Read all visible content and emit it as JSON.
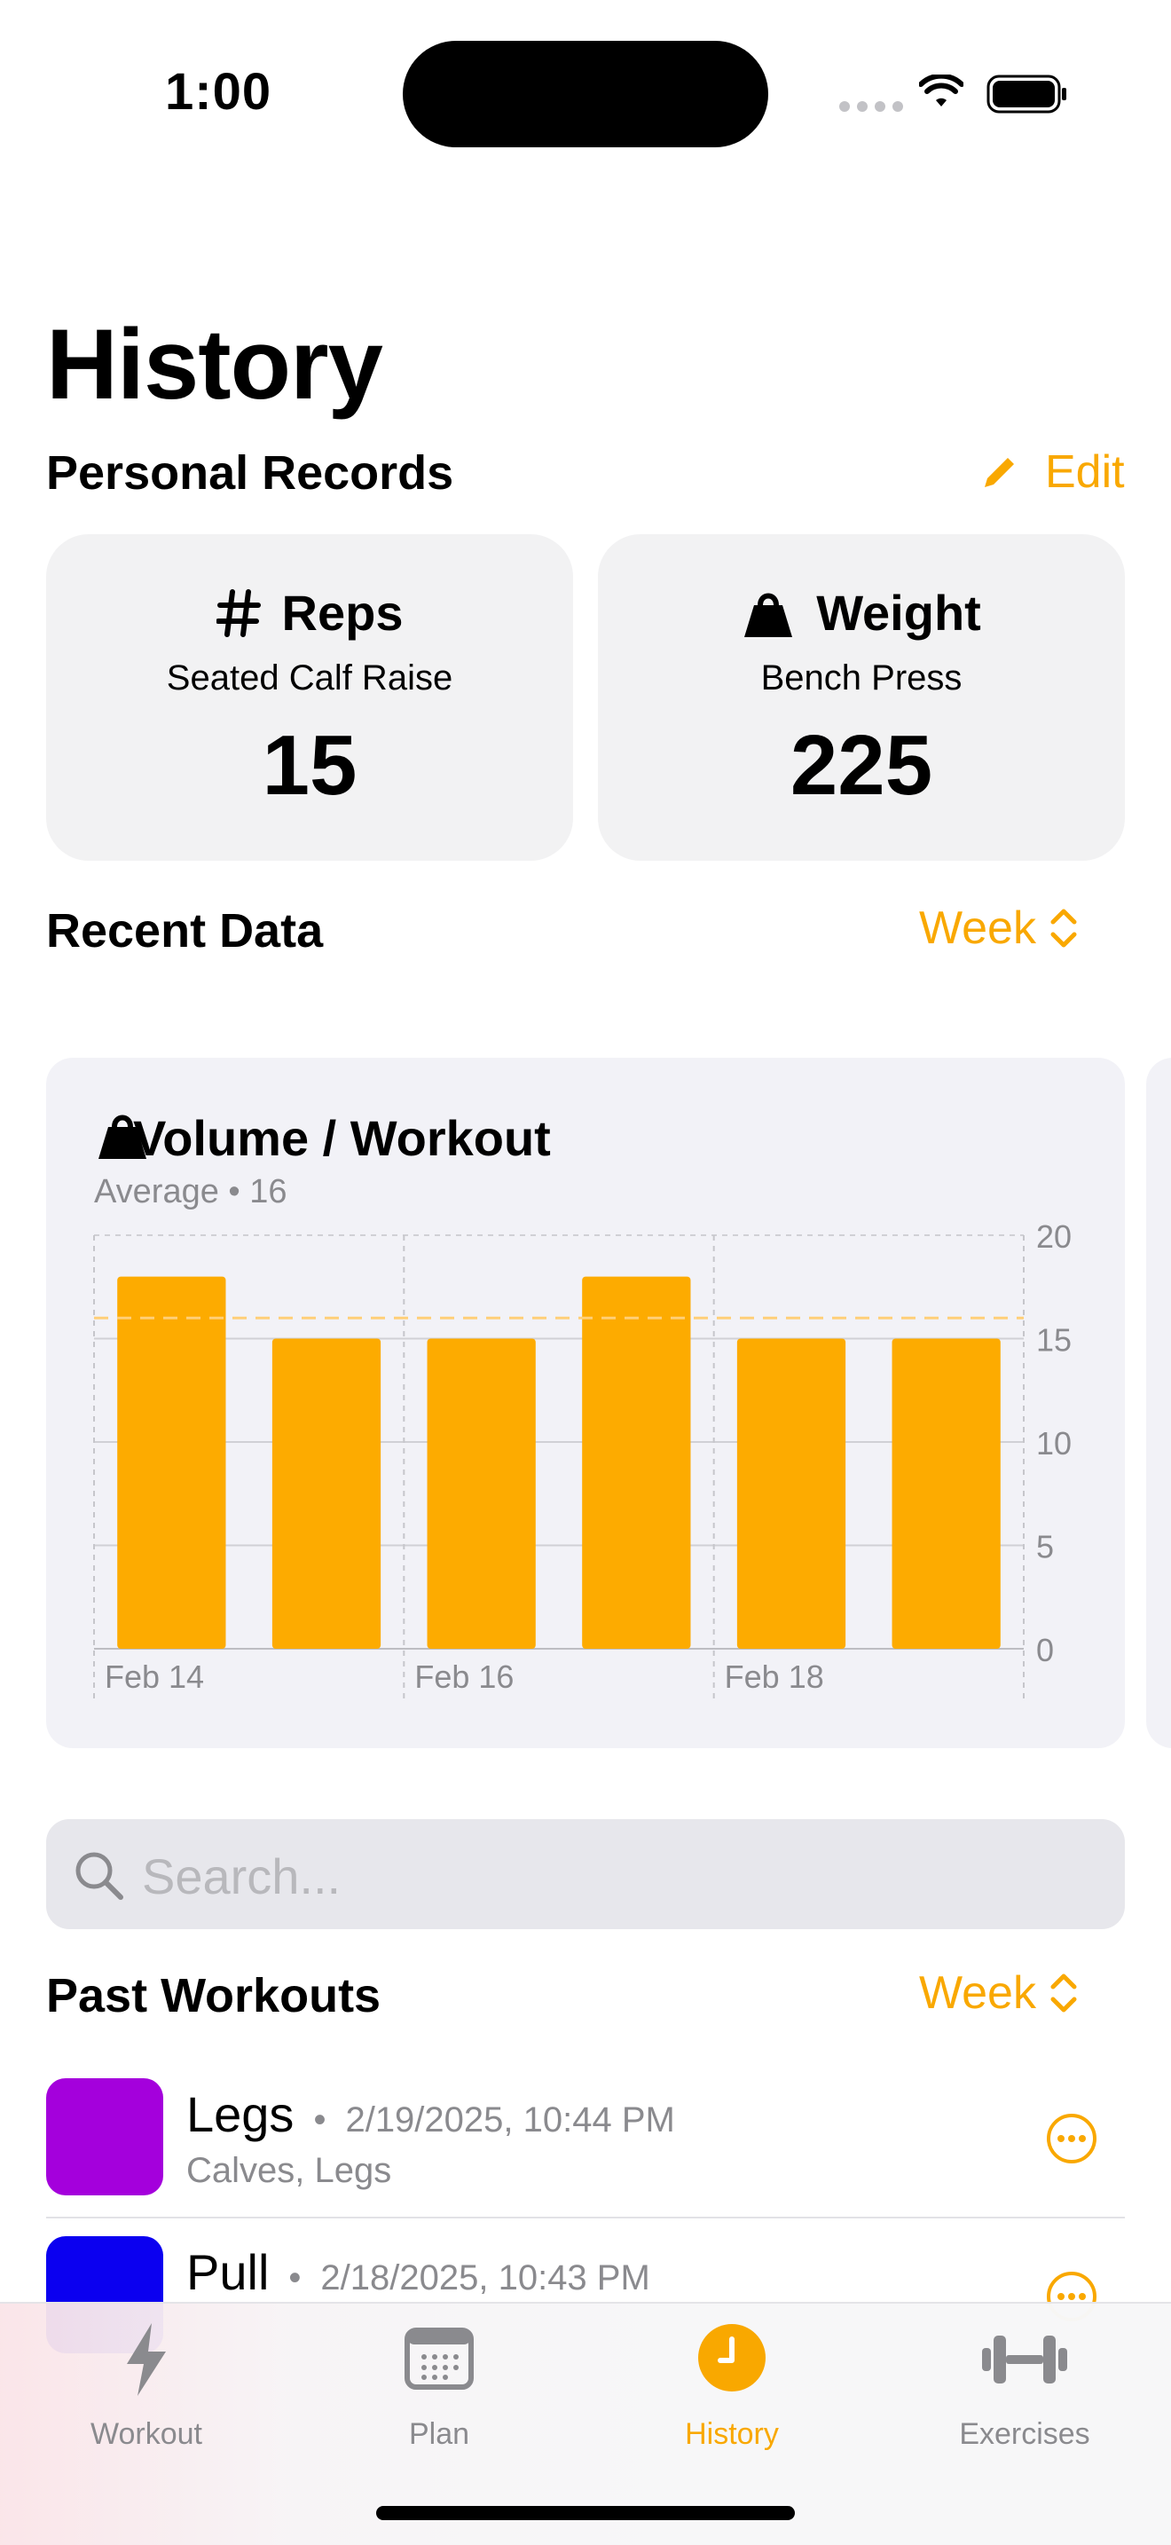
{
  "status": {
    "time": "1:00"
  },
  "page": {
    "title": "History"
  },
  "personal_records": {
    "title": "Personal Records",
    "edit_label": "Edit",
    "cards": [
      {
        "label": "Reps",
        "icon": "hash-icon",
        "exercise": "Seated Calf Raise",
        "value": "15"
      },
      {
        "label": "Weight",
        "icon": "kettlebell-icon",
        "exercise": "Bench Press",
        "value": "225"
      }
    ]
  },
  "recent_data": {
    "title": "Recent Data",
    "range_label": "Week"
  },
  "chart_data": {
    "type": "bar",
    "title": "Volume / Workout",
    "subtitle_label": "Average",
    "subtitle_value": "16",
    "values": [
      18,
      15,
      15,
      18,
      15,
      15
    ],
    "average": 16,
    "ylim": [
      0,
      20
    ],
    "y_ticks": [
      "0",
      "5",
      "10",
      "15",
      "20"
    ],
    "x_labels": [
      "Feb 14",
      "Feb 16",
      "Feb 18"
    ],
    "grid": true,
    "bar_color": "#fdab00"
  },
  "search": {
    "placeholder": "Search..."
  },
  "past_workouts": {
    "title": "Past Workouts",
    "range_label": "Week",
    "items": [
      {
        "name": "Legs",
        "date": "2/19/2025, 10:44 PM",
        "tags": "Calves, Legs",
        "color": "#a400dc"
      },
      {
        "name": "Pull",
        "date": "2/18/2025, 10:43 PM",
        "tags": "",
        "color": "#0b00f0"
      }
    ]
  },
  "tabbar": {
    "tabs": [
      {
        "label": "Workout",
        "icon": "bolt-icon",
        "active": false
      },
      {
        "label": "Plan",
        "icon": "calendar-icon",
        "active": false
      },
      {
        "label": "History",
        "icon": "clock-icon",
        "active": true
      },
      {
        "label": "Exercises",
        "icon": "dumbbell-icon",
        "active": false
      }
    ]
  },
  "colors": {
    "accent": "#f9a800",
    "card": "#f2f2f3",
    "chart_bg": "#f2f2f7"
  }
}
